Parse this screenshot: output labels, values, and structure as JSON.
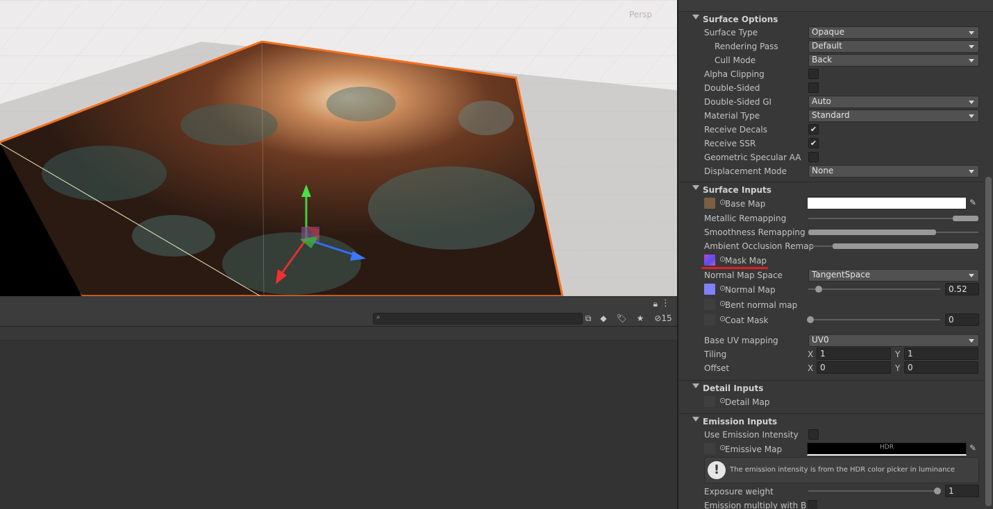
{
  "scene": {
    "label": "Persp"
  },
  "project_panel": {
    "search": {
      "placeholder": ""
    },
    "hidden_count": "15"
  },
  "inspector": {
    "surface_options": {
      "header": "Surface Options",
      "surface_type": {
        "label": "Surface Type",
        "value": "Opaque"
      },
      "rendering_pass": {
        "label": "Rendering Pass",
        "value": "Default"
      },
      "cull_mode": {
        "label": "Cull Mode",
        "value": "Back"
      },
      "alpha_clipping": {
        "label": "Alpha Clipping",
        "checked": false
      },
      "double_sided": {
        "label": "Double-Sided",
        "checked": false
      },
      "double_sided_gi": {
        "label": "Double-Sided GI",
        "value": "Auto"
      },
      "material_type": {
        "label": "Material Type",
        "value": "Standard"
      },
      "receive_decals": {
        "label": "Receive Decals",
        "checked": true
      },
      "receive_ssr": {
        "label": "Receive SSR",
        "checked": true
      },
      "geometric_specular_aa": {
        "label": "Geometric Specular AA",
        "checked": false
      },
      "displacement_mode": {
        "label": "Displacement Mode",
        "value": "None"
      }
    },
    "surface_inputs": {
      "header": "Surface Inputs",
      "base_map": {
        "label": "Base Map",
        "color": "#ffffff"
      },
      "metallic_remapping": {
        "label": "Metallic Remapping",
        "range": [
          0.9,
          1.0
        ]
      },
      "smoothness_remapping": {
        "label": "Smoothness Remapping",
        "range": [
          0.0,
          0.75
        ]
      },
      "ao_remap": {
        "label": "Ambient Occlusion Remap",
        "range": [
          0.15,
          1.0
        ]
      },
      "mask_map": {
        "label": "Mask Map"
      },
      "normal_map_space": {
        "label": "Normal Map Space",
        "value": "TangentSpace"
      },
      "normal_map": {
        "label": "Normal Map",
        "value": "0.52"
      },
      "bent_normal_map": {
        "label": "Bent normal map"
      },
      "coat_mask": {
        "label": "Coat Mask",
        "value": "0"
      },
      "base_uv_mapping": {
        "label": "Base UV mapping",
        "value": "UV0"
      },
      "tiling": {
        "label": "Tiling",
        "x_label": "X",
        "y_label": "Y",
        "x": "1",
        "y": "1"
      },
      "offset": {
        "label": "Offset",
        "x_label": "X",
        "y_label": "Y",
        "x": "0",
        "y": "0"
      }
    },
    "detail_inputs": {
      "header": "Detail Inputs",
      "detail_map": {
        "label": "Detail Map"
      }
    },
    "emission_inputs": {
      "header": "Emission Inputs",
      "use_emission_intensity": {
        "label": "Use Emission Intensity",
        "checked": false
      },
      "emissive_map": {
        "label": "Emissive Map",
        "hdr_label": "HDR"
      },
      "info": "The emission intensity is from the HDR color picker in luminance",
      "exposure_weight": {
        "label": "Exposure weight",
        "value": "1"
      },
      "emission_multiply": {
        "label": "Emission multiply with Bas"
      }
    }
  },
  "colors": {
    "selection_outline": "#f07020",
    "annotation_underline": "#e0201c",
    "panel_bg": "#383838"
  }
}
